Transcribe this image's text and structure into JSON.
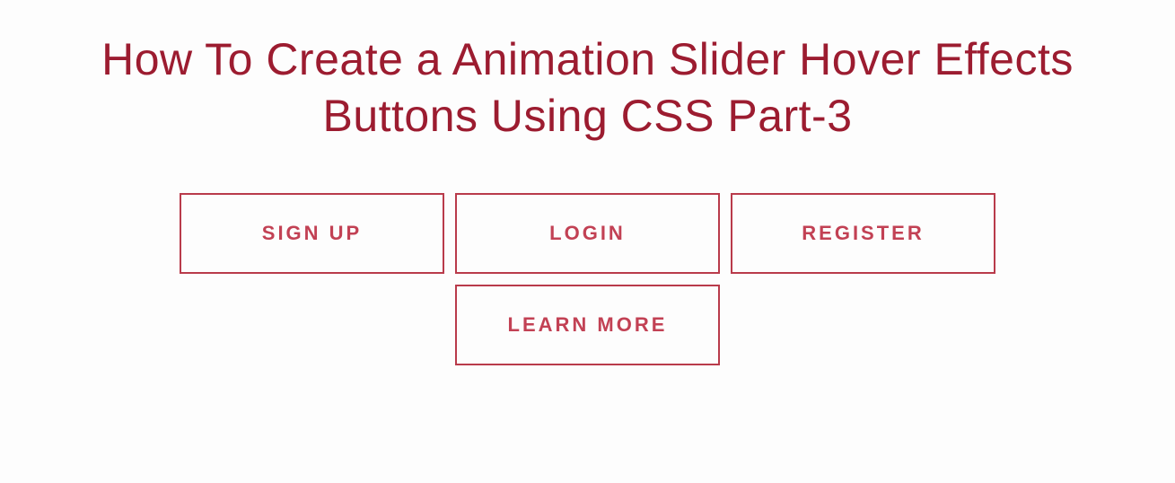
{
  "title": "How To Create a Animation Slider Hover Effects Buttons Using CSS Part-3",
  "buttons": {
    "signup": "SIGN UP",
    "login": "LOGIN",
    "register": "REGISTER",
    "learnmore": "LEARN MORE"
  },
  "colors": {
    "primary": "#9c1c30",
    "button_border": "#b93b4b",
    "button_text": "#c24154"
  }
}
